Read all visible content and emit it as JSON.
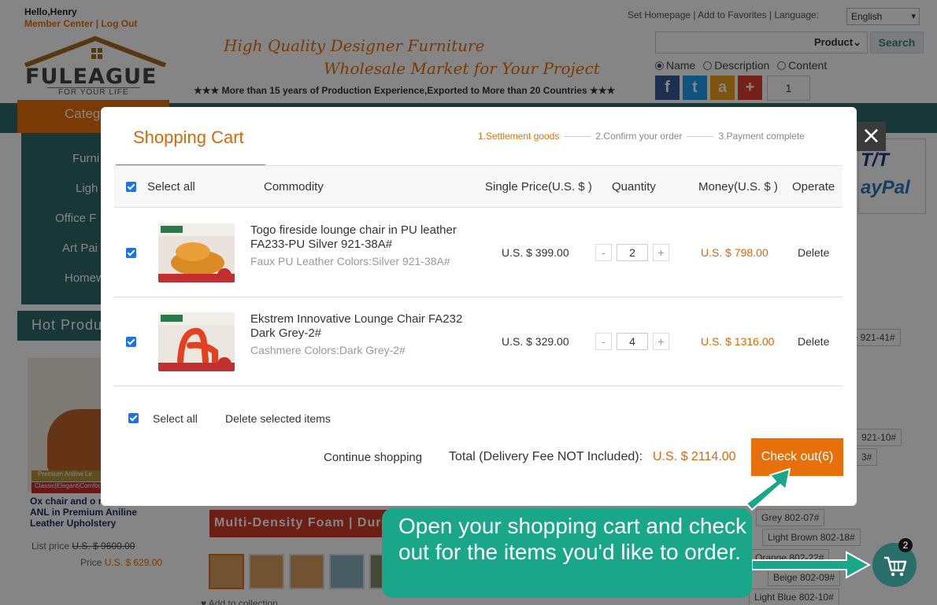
{
  "header": {
    "greeting": "Hello,Henry",
    "member_center": "Member Center",
    "divider": "|",
    "logout": "Log Out",
    "toplinks": "Set Homepage | Add to Favorites | Language:",
    "language": "English",
    "logo_text": "FULEAGUE",
    "logo_sub": "FOR YOUR LIFE",
    "slogan_line1": "High Quality Designer Furniture",
    "slogan_line2": "Wholesale Market for Your Project",
    "slogan_line3": "★★★ More than 15 years of Production Experience,Exported to More than 20 Countries ★★★",
    "search_scope": "Product",
    "search_button": "Search",
    "radio_name": "Name",
    "radio_description": "Description",
    "radio_content": "Content",
    "qty_value": "1",
    "social": [
      "f",
      "t",
      "a",
      "+"
    ]
  },
  "sidebar": {
    "category_tab": "Categ",
    "items": [
      "Furni",
      "Ligh",
      "Office F",
      "Art Pai",
      "Homew"
    ],
    "hot_products": "Hot Produ"
  },
  "bg_product": {
    "strip1": "Premium Aniline Le",
    "strip2": "Classic|Elegant|Comfor",
    "name": "Ox chair and o replica FA048-ANL in Premium Aniline Leather Upholstery",
    "list_price_label": "List price",
    "list_price": "U.S. $ 9600.00",
    "price_label": "Price",
    "price": "U.S. $ 629.00"
  },
  "bg_colors": [
    "ge 921-41#",
    "921-10#",
    "3#",
    "Grey 802-07#",
    "Light Brown 802-18#",
    "Orange 802-22#",
    "Beige 802-09#",
    "Light Blue 802-10#"
  ],
  "bg_banner": "Multi-Density Foam | Dura",
  "bg_collect": "Add to collection",
  "paypal": {
    "tt": "T/T",
    "pp": "ayPal"
  },
  "cart": {
    "title": "Shopping Cart",
    "steps": [
      "1.Settlement goods",
      "2.Confirm your order",
      "3.Payment complete"
    ],
    "columns": {
      "select_all": "Select all",
      "commodity": "Commodity",
      "price": "Single Price(U.S. $ )",
      "quantity": "Quantity",
      "money": "Money(U.S. $ )",
      "operate": "Operate"
    },
    "items": [
      {
        "name": "Togo fireside lounge chair in PU leather FA233-PU Silver 921-38A#",
        "attr": "Faux PU Leather Colors:Silver 921-38A#",
        "price": "U.S. $ 399.00",
        "qty": "2",
        "money": "U.S. $  798.00",
        "delete": "Delete"
      },
      {
        "name": "Ekstrem Innovative Lounge Chair FA232 Dark Grey-2#",
        "attr": "Cashmere Colors:Dark Grey-2#",
        "price": "U.S. $ 329.00",
        "qty": "4",
        "money": "U.S. $  1316.00",
        "delete": "Delete"
      }
    ],
    "footer_select_all": "Select all",
    "delete_selected": "Delete selected items",
    "continue": "Continue shopping",
    "total_label": "Total (Delivery Fee NOT Included):",
    "total_value": "U.S. $  2114.00",
    "checkout": "Check out(6)",
    "close": "×",
    "minus": "-",
    "plus": "+"
  },
  "tooltip": {
    "text": "Open your shopping cart and check out for the items you'd like to order."
  },
  "cart_badge": "2",
  "colors": {
    "accent": "#e8700a",
    "teal": "#2f6a6a",
    "tooltip": "#1aa688",
    "checkbox": "#1a73e8"
  }
}
